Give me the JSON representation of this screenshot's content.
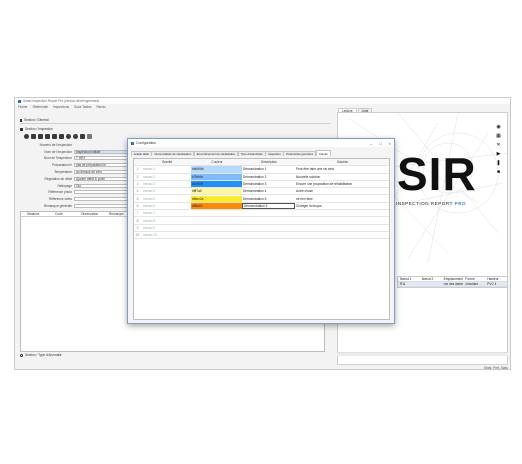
{
  "app": {
    "title": "Smart Inspection Report Pro (version développement)",
    "menu": [
      "Fichier",
      "Référentiel",
      "Inspections",
      "Sous Tables",
      "Rendu"
    ]
  },
  "left": {
    "section_general": "Section / Général",
    "section_inspection": "Section / Inspection",
    "fields": [
      {
        "label": "Numéro de l'inspection",
        "value": ""
      },
      {
        "label": "Nom de l'inspection",
        "value": "Inspection initiale"
      },
      {
        "label": "Nom de l'inspecteur",
        "value": "T HEX"
      },
      {
        "label": "Préparation le",
        "value": "pas de préparation le"
      },
      {
        "label": "Température",
        "value": "au dessus de zéro"
      },
      {
        "label": "Régulation du débit",
        "value": "Ajouter débit & profil"
      },
      {
        "label": "Nettoyage",
        "value": "Oui"
      },
      {
        "label": "Référence photo",
        "value": ""
      },
      {
        "label": "Référence vidéo",
        "value": ""
      },
      {
        "label": "Remarque générale",
        "value": ""
      }
    ],
    "table_headers": [
      "Distance",
      "Code",
      "Observation",
      "Remarque"
    ],
    "footer_section": "Section / Type d'Anomalie"
  },
  "right": {
    "tabs": [
      "Lecture",
      "Liste"
    ],
    "logo_text": "SIR",
    "subtitle": "INSPECTION REPORT",
    "subtitle_pro": "PRO",
    "table_headers": [
      "Nœud 1",
      "Nœud 2",
      "Emplacement",
      "Forme",
      "Hauteur"
    ],
    "table_row": [
      "R11",
      "",
      "rue des dames",
      "circulaire",
      "PVC 4"
    ],
    "status": "Etats: Prêt, Statu"
  },
  "dialog": {
    "title": "Configuration",
    "tabs": [
      "Entête table",
      "Nomenclature de canalisation",
      "Encombrement de canalisation",
      "Type d'étanchéité",
      "Inspection",
      "Paramètres généraux",
      "Gravité"
    ],
    "active_tab": "Gravité",
    "columns": [
      "Gravité",
      "Couleur",
      "Description",
      "Solution"
    ],
    "rows": [
      {
        "n": "1",
        "level": "niveau 1",
        "color": "#b6d9fd",
        "hex": "#b6d9fd",
        "desc": "Démonstration 1",
        "solution": "Peut être faire une vis cela"
      },
      {
        "n": "2",
        "level": "niveau 2",
        "color": "#7fbbfa",
        "hex": "#7fbbfa",
        "desc": "Démonstration 2",
        "solution": "Nouvelle solution"
      },
      {
        "n": "3",
        "level": "niveau 3",
        "color": "#1e90ff",
        "hex": "#1e90ff",
        "desc": "Démonstration 3",
        "solution": "Encore une proposition de réhabilitation"
      },
      {
        "n": "4",
        "level": "niveau 4",
        "color": "#fff7a0",
        "hex": "#fff7a0",
        "desc": "Démonstration 4",
        "solution": "Autre chose"
      },
      {
        "n": "5",
        "level": "niveau 5",
        "color": "#fbec2a",
        "hex": "#fbec2a",
        "desc": "Démonstration 5",
        "solution": "ne rien faire"
      },
      {
        "n": "6",
        "level": "niveau 6",
        "color": "#ff8a00",
        "hex": "#ff8a00",
        "desc": "Démonstration 6",
        "solution": "Changer la fonçon"
      },
      {
        "n": "7",
        "level": "niveau 7",
        "color": "",
        "hex": "",
        "desc": "",
        "solution": ""
      },
      {
        "n": "8",
        "level": "niveau 8",
        "color": "",
        "hex": "",
        "desc": "",
        "solution": ""
      },
      {
        "n": "9",
        "level": "niveau 9",
        "color": "",
        "hex": "",
        "desc": "",
        "solution": ""
      },
      {
        "n": "10",
        "level": "niveau 10",
        "color": "",
        "hex": "",
        "desc": "",
        "solution": ""
      }
    ]
  }
}
